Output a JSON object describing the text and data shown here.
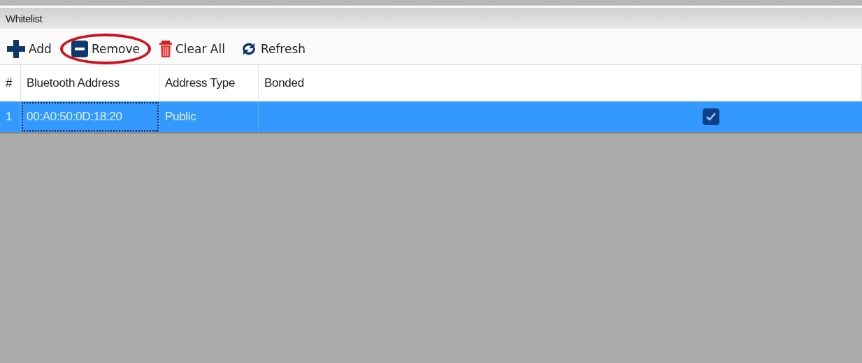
{
  "panel": {
    "title": "Whitelist"
  },
  "toolbar": [
    {
      "label": "Add",
      "kind": "add",
      "circled": false
    },
    {
      "label": "Remove",
      "kind": "remove",
      "circled": true
    },
    {
      "label": "Clear All",
      "kind": "clear",
      "circled": false
    },
    {
      "label": "Refresh",
      "kind": "refresh",
      "circled": false
    }
  ],
  "table": {
    "columns": [
      "#",
      "Bluetooth Address",
      "Address Type",
      "Bonded"
    ],
    "rows": [
      {
        "index": "1",
        "address": "00:A0:50:0D:18:20",
        "address_type": "Public",
        "bonded": true,
        "selected": true
      }
    ]
  }
}
